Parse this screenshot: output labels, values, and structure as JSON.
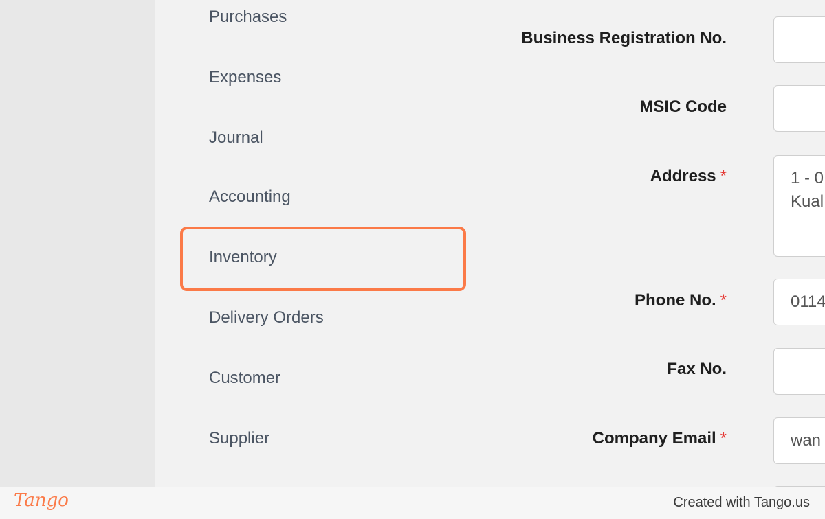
{
  "sidebar": {
    "items": [
      {
        "label": "Purchases"
      },
      {
        "label": "Expenses"
      },
      {
        "label": "Journal"
      },
      {
        "label": "Accounting"
      },
      {
        "label": "Inventory"
      },
      {
        "label": "Delivery Orders"
      },
      {
        "label": "Customer"
      },
      {
        "label": "Supplier"
      }
    ]
  },
  "form": {
    "business_reg": {
      "label": "Business Registration No.",
      "value": ""
    },
    "msic": {
      "label": "MSIC Code",
      "value": ""
    },
    "address": {
      "label": "Address",
      "required": "*",
      "value": "1 - 0\nKual"
    },
    "phone": {
      "label": "Phone No.",
      "required": "*",
      "value": "0114"
    },
    "fax": {
      "label": "Fax No.",
      "value": ""
    },
    "email": {
      "label": "Company Email",
      "required": "*",
      "value": "wan"
    }
  },
  "footer": {
    "logo": "Tango",
    "credit": "Created with Tango.us"
  },
  "colors": {
    "highlight": "#fb7a48",
    "required": "#e53935"
  }
}
